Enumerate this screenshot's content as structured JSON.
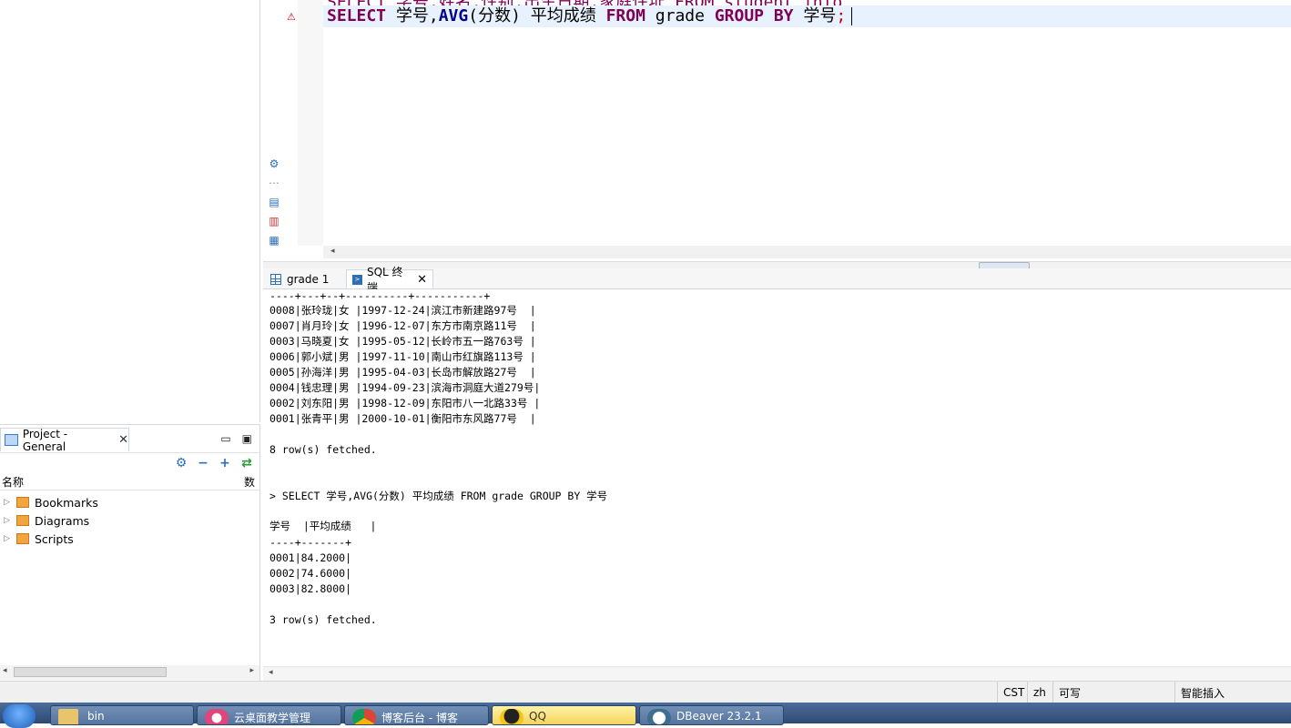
{
  "editor": {
    "partial_line": "SELECT 学号,姓名,性别,出生日期,家庭住址 FROM student_info",
    "line": {
      "kw_select": "SELECT",
      "cols": " 学号,",
      "fn_avg": "AVG",
      "args": "(分数) 平均成绩 ",
      "kw_from": "FROM",
      "table": " grade ",
      "kw_group": "GROUP BY",
      "col2": " 学号",
      "semicolon": ";"
    }
  },
  "project_panel": {
    "tab_label": "Project - General",
    "col_name": "名称",
    "col_data": "数",
    "items": [
      {
        "label": "Bookmarks"
      },
      {
        "label": "Diagrams"
      },
      {
        "label": "Scripts"
      }
    ]
  },
  "results": {
    "tabs": [
      {
        "label": "grade 1"
      },
      {
        "label": "SQL 终端"
      }
    ]
  },
  "chart_data": {
    "type": "table",
    "tables": [
      {
        "separator": "----+---+--+----------+-----------+",
        "rows": [
          "0008|张玲珑|女 |1997-12-24|滨江市新建路97号  |",
          "0007|肖月玲|女 |1996-12-07|东方市南京路11号  |",
          "0003|马晓夏|女 |1995-05-12|长岭市五一路763号 |",
          "0006|郭小斌|男 |1997-11-10|南山市红旗路113号 |",
          "0005|孙海洋|男 |1995-04-03|长岛市解放路27号  |",
          "0004|钱忠理|男 |1994-09-23|滨海市洞庭大道279号|",
          "0002|刘东阳|男 |1998-12-09|东阳市八一北路33号 |",
          "0001|张青平|男 |2000-10-01|衡阳市东风路77号  |"
        ],
        "footer": "8 row(s) fetched."
      },
      {
        "query": "> SELECT 学号,AVG(分数) 平均成绩 FROM grade GROUP BY 学号",
        "header": "学号  |平均成绩   |",
        "separator": "----+-------+",
        "columns": [
          "学号",
          "平均成绩"
        ],
        "records": [
          [
            "0001",
            "84.2000"
          ],
          [
            "0002",
            "74.6000"
          ],
          [
            "0003",
            "82.8000"
          ]
        ],
        "rows": [
          "0001|84.2000|",
          "0002|74.6000|",
          "0003|82.8000|"
        ],
        "footer": "3 row(s) fetched."
      }
    ]
  },
  "statusbar": {
    "timezone": "CST",
    "locale": "zh",
    "writable": "可写",
    "insert_mode": "智能插入"
  },
  "taskbar": {
    "items": [
      {
        "label": "bin"
      },
      {
        "label": "云桌面教学管理"
      },
      {
        "label": "博客后台 - 博客"
      },
      {
        "label": "QQ"
      },
      {
        "label": "DBeaver 23.2.1"
      }
    ]
  },
  "colors": {
    "keyword": "#7f0055",
    "function": "#00008b",
    "error": "#cc0000",
    "accent": "#2d6fb5"
  }
}
